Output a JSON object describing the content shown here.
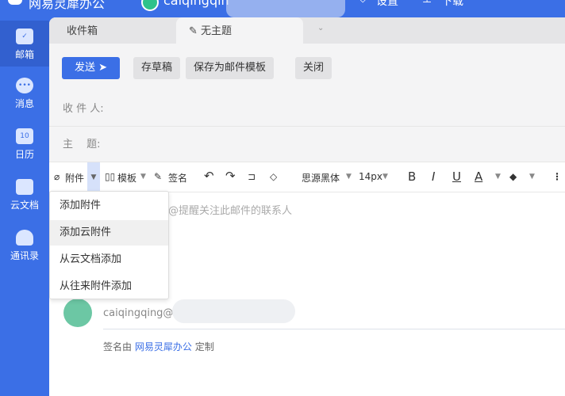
{
  "topbar": {
    "app_title": "网易灵犀办公",
    "user": "caiqingqin",
    "settings": "设置",
    "download": "下载"
  },
  "sidebar": {
    "items": [
      {
        "label": "邮箱",
        "icon": "mail-icon",
        "active": true
      },
      {
        "label": "消息",
        "icon": "chat-icon"
      },
      {
        "label": "日历",
        "icon": "calendar-icon",
        "day": "10"
      },
      {
        "label": "云文档",
        "icon": "cloud-folder-icon"
      },
      {
        "label": "通讯录",
        "icon": "contacts-icon"
      }
    ]
  },
  "tabs": [
    {
      "label": "收件箱"
    },
    {
      "label": "无主题",
      "active": true
    }
  ],
  "actions": {
    "send": "发送",
    "draft": "存草稿",
    "save_template": "保存为邮件模板",
    "close": "关闭"
  },
  "fields": {
    "to": "收 件 人:",
    "subject": "主　 题:"
  },
  "toolbar": {
    "attach": "附件",
    "template": "模板",
    "signature": "签名",
    "font": "思源黑体",
    "size": "14px"
  },
  "attach_menu": [
    "添加附件",
    "添加云附件",
    "从云文档添加",
    "从往来附件添加"
  ],
  "editor": {
    "placeholder": "@提醒关注此邮件的联系人",
    "sig_name": "caiqingqing@",
    "sig_prefix": "签名由",
    "sig_link": "网易灵犀办公",
    "sig_suffix": "定制"
  },
  "colors": {
    "accent": "#3b6fe6"
  }
}
